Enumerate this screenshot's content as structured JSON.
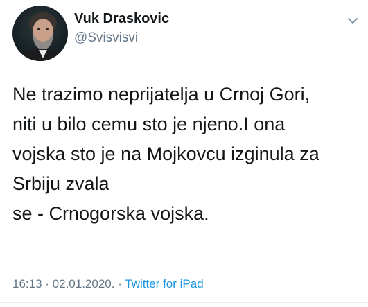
{
  "author": {
    "display_name": "Vuk Draskovic",
    "handle": "@Svisvisvi"
  },
  "tweet": {
    "text": "Ne trazimo neprijatelja u Crnoj Gori,\nniti u bilo cemu sto je njeno.I ona\nvojska sto je na Mojkovcu izginula za\nSrbiju zvala\nse - Crnogorska vojska.",
    "time": "16:13",
    "separator": " · ",
    "date": "02.01.2020.",
    "separator2": " · ",
    "source": "Twitter for iPad"
  },
  "icons": {
    "menu": "chevron-down-icon",
    "avatar": "avatar"
  },
  "colors": {
    "text": "#14171a",
    "secondary": "#657786",
    "link": "#1b95e0"
  }
}
